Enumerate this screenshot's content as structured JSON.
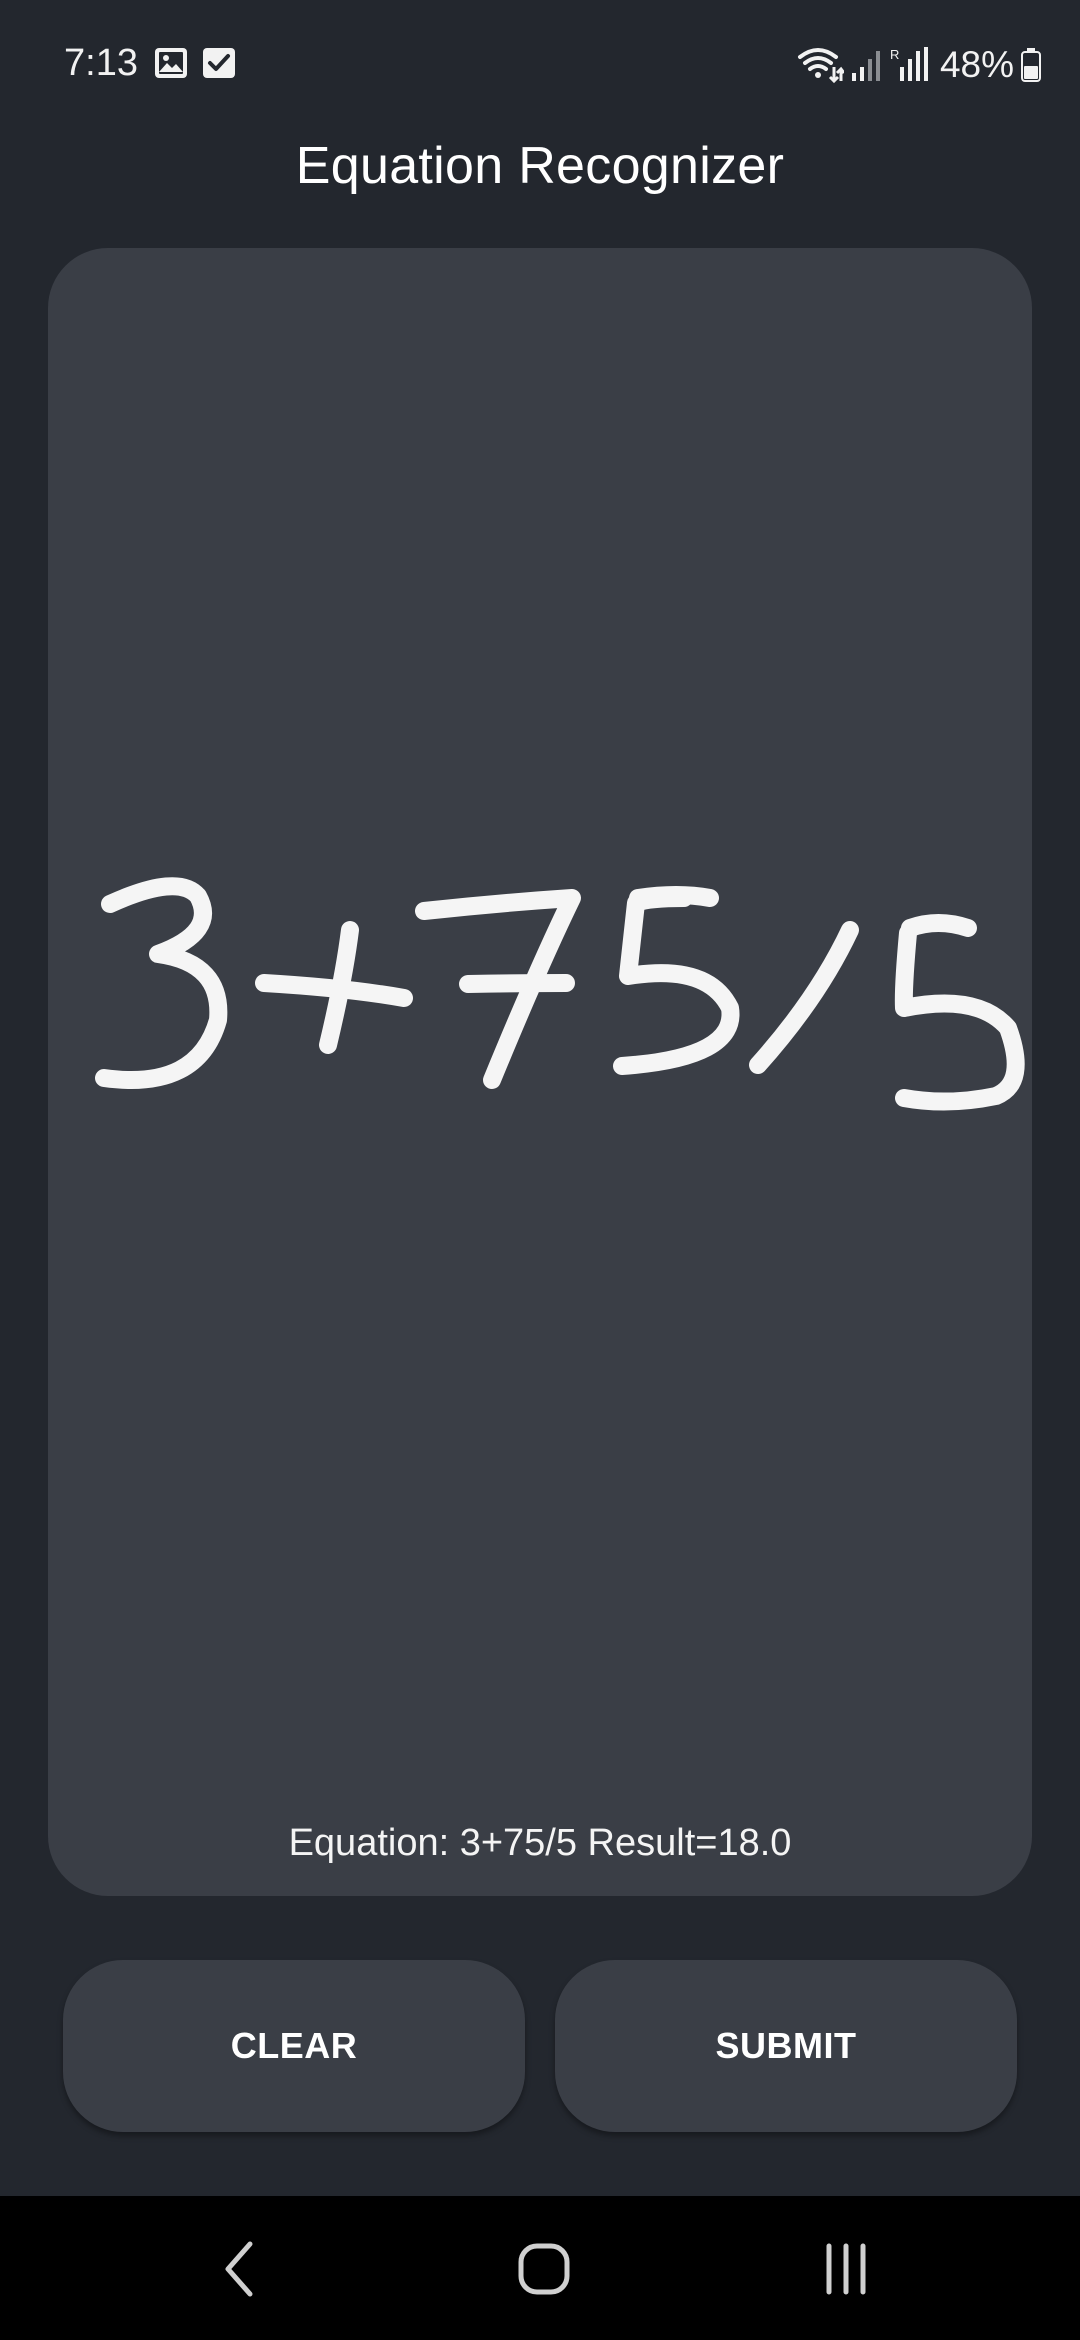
{
  "status_bar": {
    "time": "7:13",
    "icons_left": [
      "gallery-icon",
      "check-box-icon"
    ],
    "icons_right": [
      "wifi-icon",
      "signal-icon",
      "signal-icon"
    ],
    "battery_text": "48%"
  },
  "app": {
    "title": "Equation Recognizer"
  },
  "canvas": {
    "handwritten_text": "3+75/5",
    "result_text": "Equation: 3+75/5 Result=18.0",
    "background_color": "#3a3e46",
    "stroke_color": "#f5f5f5"
  },
  "buttons": {
    "clear_label": "CLEAR",
    "submit_label": "SUBMIT"
  },
  "nav_bar": {
    "items": [
      "back-icon",
      "home-icon",
      "recents-icon"
    ]
  },
  "colors": {
    "background": "#23272e",
    "surface": "#3a3e46",
    "text": "#ffffff"
  }
}
